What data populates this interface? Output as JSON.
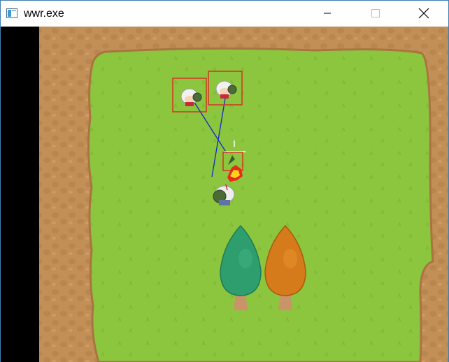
{
  "window": {
    "title": "wwr.exe",
    "controls": {
      "minimize": "minimize-icon",
      "maximize": "maximize-icon",
      "close": "close-icon"
    }
  },
  "game": {
    "colors": {
      "grass": "#8cc63e",
      "dirt": "#c28f57",
      "dirt_dark": "#a9743f",
      "target_box": "#e11d1d",
      "aim_line": "#1428c8",
      "tree_green": "#2f9e6f",
      "tree_orange": "#d57b1c",
      "trunk": "#c89468"
    },
    "entities": [
      {
        "kind": "enemy",
        "icon": "enemy-sprite-icon",
        "targeted": true
      },
      {
        "kind": "enemy",
        "icon": "enemy-sprite-icon",
        "targeted": true
      },
      {
        "kind": "projectile",
        "icon": "fireball-icon",
        "targeted": true
      },
      {
        "kind": "player",
        "icon": "player-sprite-icon",
        "targeted": false
      }
    ],
    "props": [
      {
        "kind": "tree",
        "icon": "green-tree-icon"
      },
      {
        "kind": "tree",
        "icon": "orange-tree-icon"
      }
    ]
  }
}
